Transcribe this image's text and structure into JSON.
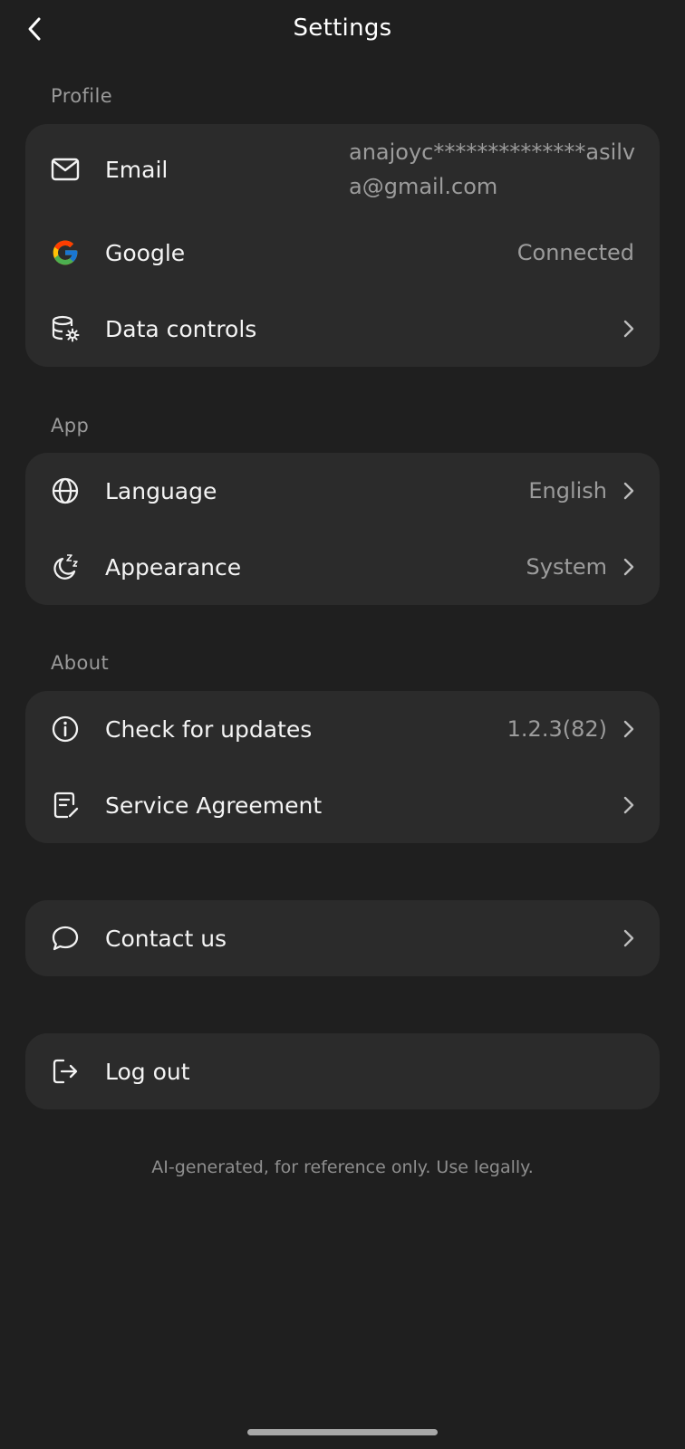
{
  "header": {
    "title": "Settings"
  },
  "profile": {
    "section_title": "Profile",
    "email": {
      "label": "Email",
      "value": "anajoyc**************asilva@gmail.com"
    },
    "google": {
      "label": "Google",
      "value": "Connected"
    },
    "data_controls": {
      "label": "Data controls"
    }
  },
  "app": {
    "section_title": "App",
    "language": {
      "label": "Language",
      "value": "English"
    },
    "appearance": {
      "label": "Appearance",
      "value": "System"
    }
  },
  "about": {
    "section_title": "About",
    "updates": {
      "label": "Check for updates",
      "value": "1.2.3(82)"
    },
    "agreement": {
      "label": "Service Agreement"
    }
  },
  "contact": {
    "label": "Contact us"
  },
  "logout": {
    "label": "Log out"
  },
  "footer": {
    "note": "AI-generated, for reference only. Use legally."
  },
  "colors": {
    "background": "#1f1f1f",
    "card": "#2b2b2b",
    "secondary_text": "#9c9c9c",
    "google_blue": "#4285F4",
    "google_red": "#EA4335",
    "google_yellow": "#FBBC05",
    "google_green": "#34A853"
  },
  "icons": {
    "back": "chevron-left-icon",
    "email": "mail-icon",
    "google": "google-logo-icon",
    "data_controls": "database-gear-icon",
    "language": "globe-icon",
    "appearance": "moon-sleep-icon",
    "updates": "info-circle-icon",
    "agreement": "document-edit-icon",
    "contact": "chat-bubble-icon",
    "logout": "logout-icon",
    "chevron": "chevron-right-icon"
  }
}
